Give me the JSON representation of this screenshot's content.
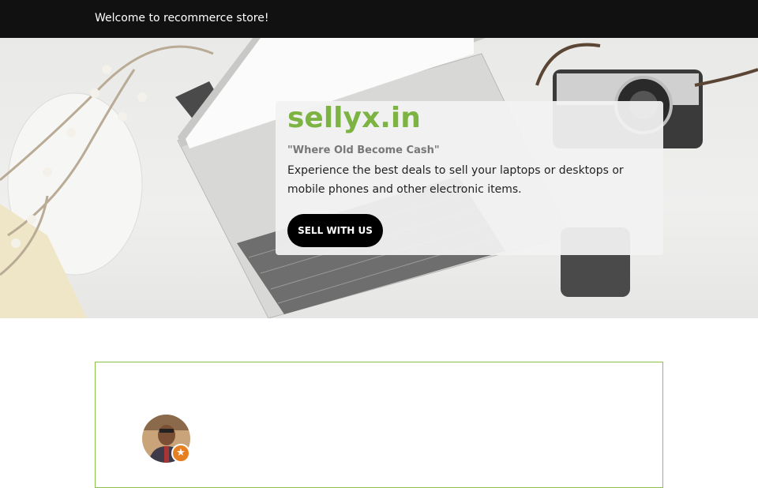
{
  "topbar": {
    "welcome_text": "Welcome to recommerce store!"
  },
  "hero": {
    "brand": "sellyx.in",
    "tagline": "\"Where Old Become Cash\"",
    "description": "Experience the best deals to sell your laptops or desktops or mobile phones and other electronic items.",
    "cta_label": "SELL WITH US"
  },
  "colors": {
    "brand": "#7cb342",
    "topbar": "#111111",
    "cta": "#000000",
    "review_border": "#8bc34a",
    "badge": "#e67e22"
  },
  "review": {
    "avatar_icon": "user-avatar",
    "badge_icon": "star-icon"
  }
}
